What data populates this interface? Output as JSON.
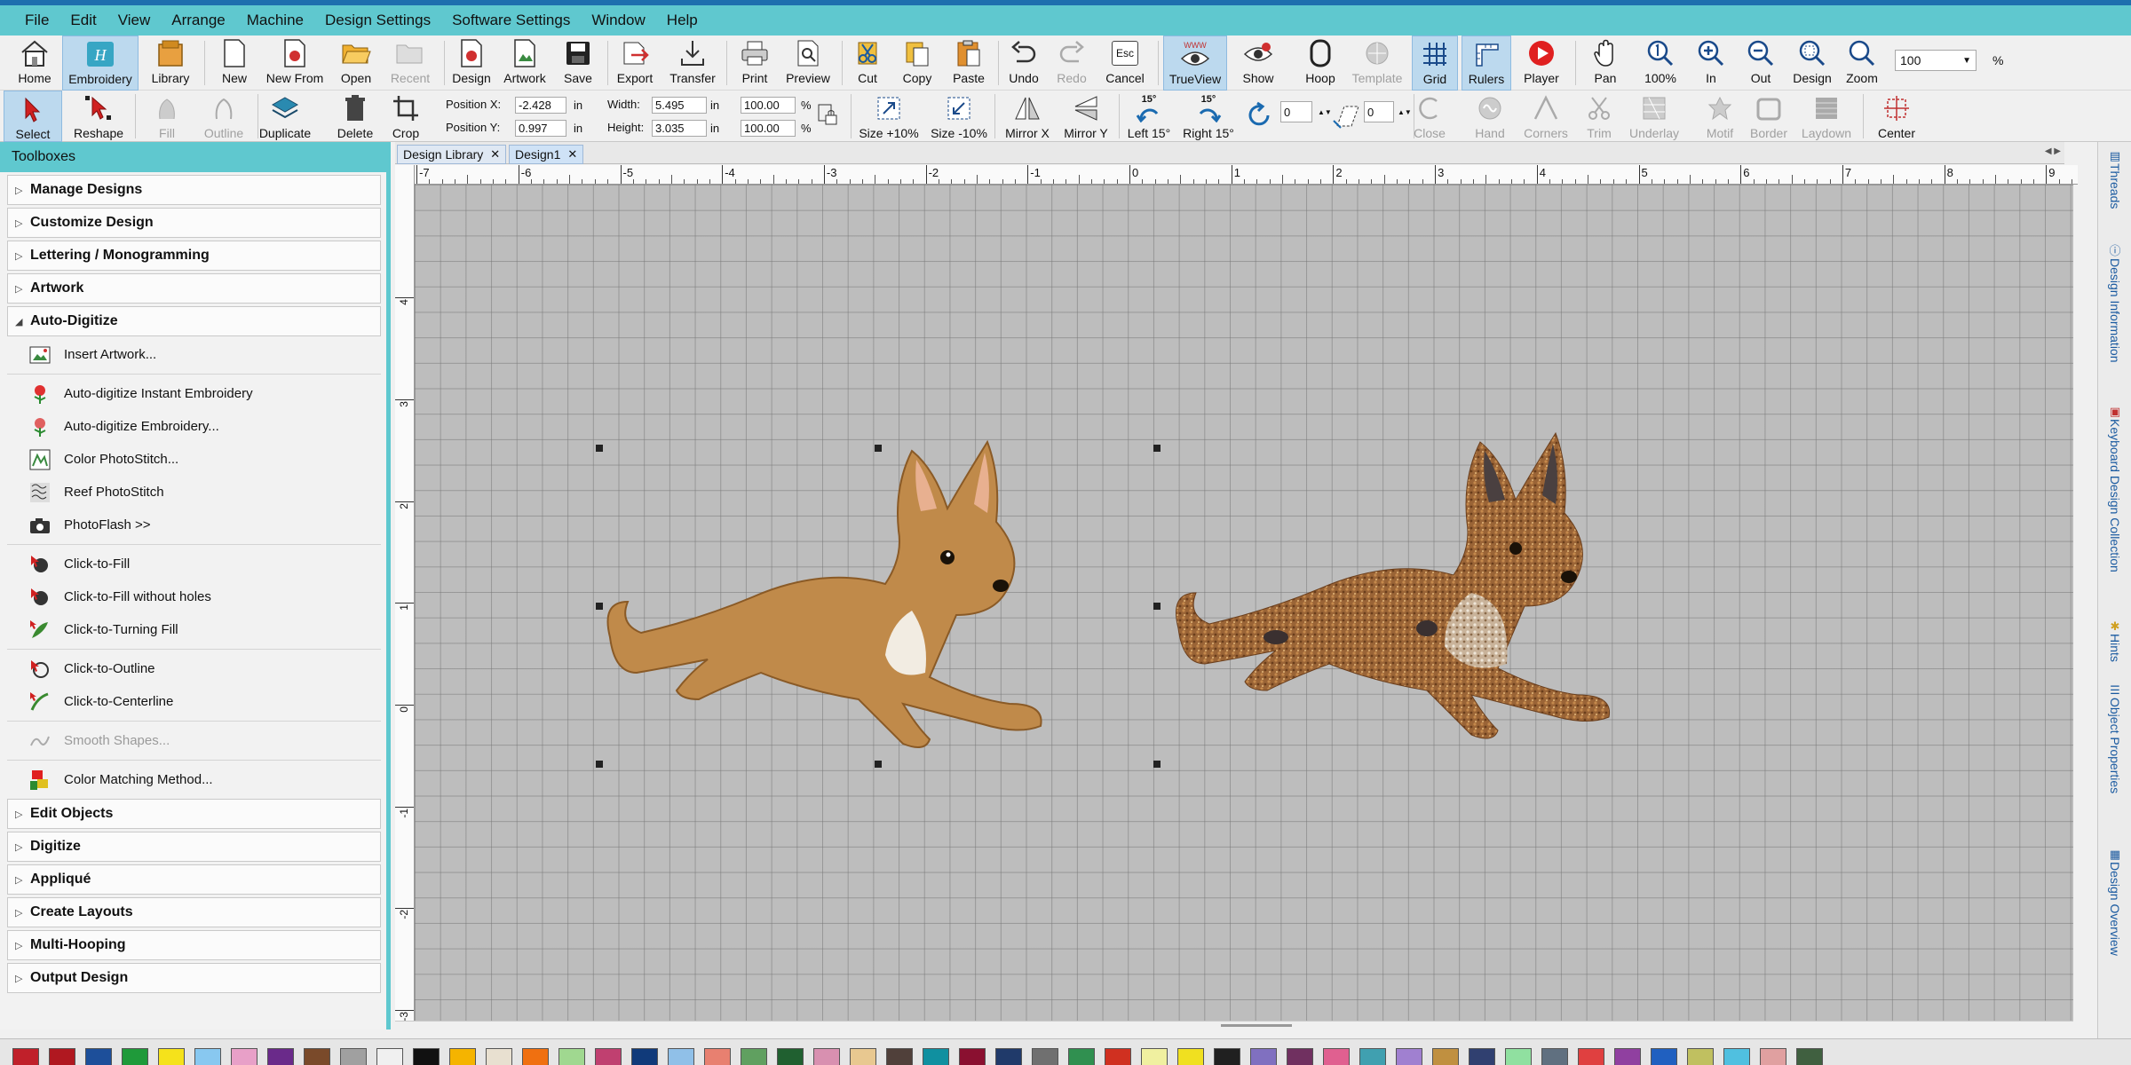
{
  "menu": [
    "File",
    "Edit",
    "View",
    "Arrange",
    "Machine",
    "Design Settings",
    "Software Settings",
    "Window",
    "Help"
  ],
  "ribbon1": {
    "home": "Home",
    "embroidery": "Embroidery",
    "library": "Library",
    "new": "New",
    "new_from": "New From",
    "open": "Open",
    "recent": "Recent",
    "design": "Design",
    "artwork": "Artwork",
    "save": "Save",
    "export": "Export",
    "transfer": "Transfer",
    "print": "Print",
    "preview": "Preview",
    "cut": "Cut",
    "copy": "Copy",
    "paste": "Paste",
    "undo": "Undo",
    "redo": "Redo",
    "cancel": "Cancel",
    "cancel_key": "Esc",
    "trueview": "TrueView",
    "trueview_badge": "WWW",
    "show": "Show",
    "hoop": "Hoop",
    "template": "Template",
    "grid": "Grid",
    "rulers": "Rulers",
    "player": "Player",
    "pan": "Pan",
    "zoom100": "100%",
    "in": "In",
    "out": "Out",
    "zoom_design": "Design",
    "zoom": "Zoom",
    "zoom_value": "100",
    "zoom_unit": "%"
  },
  "ribbon2": {
    "select": "Select",
    "reshape": "Reshape",
    "fill": "Fill",
    "outline": "Outline",
    "duplicate": "Duplicate",
    "delete": "Delete",
    "crop": "Crop",
    "posx_label": "Position X:",
    "posx": "-2.428",
    "posy_label": "Position Y:",
    "posy": "0.997",
    "width_label": "Width:",
    "width": "5.495",
    "height_label": "Height:",
    "height": "3.035",
    "unit_in": "in",
    "scale_w": "100.00",
    "scale_h": "100.00",
    "pct": "%",
    "size_up": "Size +10%",
    "size_down": "Size -10%",
    "mirror_x": "Mirror X",
    "mirror_y": "Mirror Y",
    "left15": "Left 15°",
    "right15": "Right 15°",
    "rot_badge": "15°",
    "rotate_value": "0",
    "slant_value": "0",
    "close": "Close",
    "hand": "Hand",
    "corners": "Corners",
    "trim": "Trim",
    "underlay": "Underlay",
    "motif": "Motif",
    "border": "Border",
    "laydown": "Laydown",
    "center": "Center"
  },
  "toolbox": {
    "title": "Toolboxes",
    "top_categories": [
      "Manage Designs",
      "Customize Design",
      "Lettering / Monogramming",
      "Artwork",
      "Auto-Digitize"
    ],
    "tools_group1": [
      "Insert Artwork..."
    ],
    "tools_group2": [
      "Auto-digitize Instant Embroidery",
      "Auto-digitize Embroidery...",
      "Color PhotoStitch...",
      "Reef PhotoStitch",
      "PhotoFlash >>"
    ],
    "tools_group3": [
      "Click-to-Fill",
      "Click-to-Fill without holes",
      "Click-to-Turning Fill"
    ],
    "tools_group4": [
      "Click-to-Outline",
      "Click-to-Centerline"
    ],
    "tools_group5": [
      "Smooth Shapes..."
    ],
    "tools_group6": [
      "Color Matching Method..."
    ],
    "bottom_categories": [
      "Edit Objects",
      "Digitize",
      "Appliqué",
      "Create Layouts",
      "Multi-Hooping",
      "Output Design"
    ]
  },
  "tabs": [
    "Design Library",
    "Design1"
  ],
  "ruler": {
    "h_labels": [
      "-7",
      "-6",
      "-5",
      "-4",
      "-3",
      "-2",
      "-1",
      "0",
      "1",
      "2",
      "3",
      "4",
      "5",
      "6",
      "7",
      "8",
      "9"
    ],
    "v_labels": [
      "4",
      "3",
      "2",
      "1",
      "0",
      "-1",
      "-2",
      "-3"
    ]
  },
  "side_panels": [
    "Threads",
    "Design Information",
    "Keyboard Design Collection",
    "Hints",
    "Object Properties",
    "Design Overview"
  ],
  "palette_colors": [
    "#c0202a",
    "#b01820",
    "#1d4f9a",
    "#1f9a3a",
    "#f5e21b",
    "#88c8f0",
    "#e8a0c8",
    "#6a2a8a",
    "#7a4a2a",
    "#a0a0a0",
    "#f0f0f0",
    "#111111",
    "#f5b400",
    "#e8e0d0",
    "#f07010",
    "#a0d890",
    "#c04070",
    "#103a7a",
    "#90c0e8",
    "#e88070",
    "#60a060",
    "#206030",
    "#d890b0",
    "#e8c890",
    "#50403a",
    "#1090a0",
    "#8a1030",
    "#203a6a",
    "#707070",
    "#309050",
    "#d03020",
    "#f0f0a0",
    "#f0e020",
    "#202020",
    "#8070c0",
    "#703060",
    "#e06090",
    "#40a0b0",
    "#a080d0",
    "#c09040",
    "#304070",
    "#90e0a0",
    "#607080",
    "#e04040",
    "#9040a0",
    "#2060c0",
    "#c0c060",
    "#50c0e0",
    "#e0a0a0",
    "#406040"
  ]
}
